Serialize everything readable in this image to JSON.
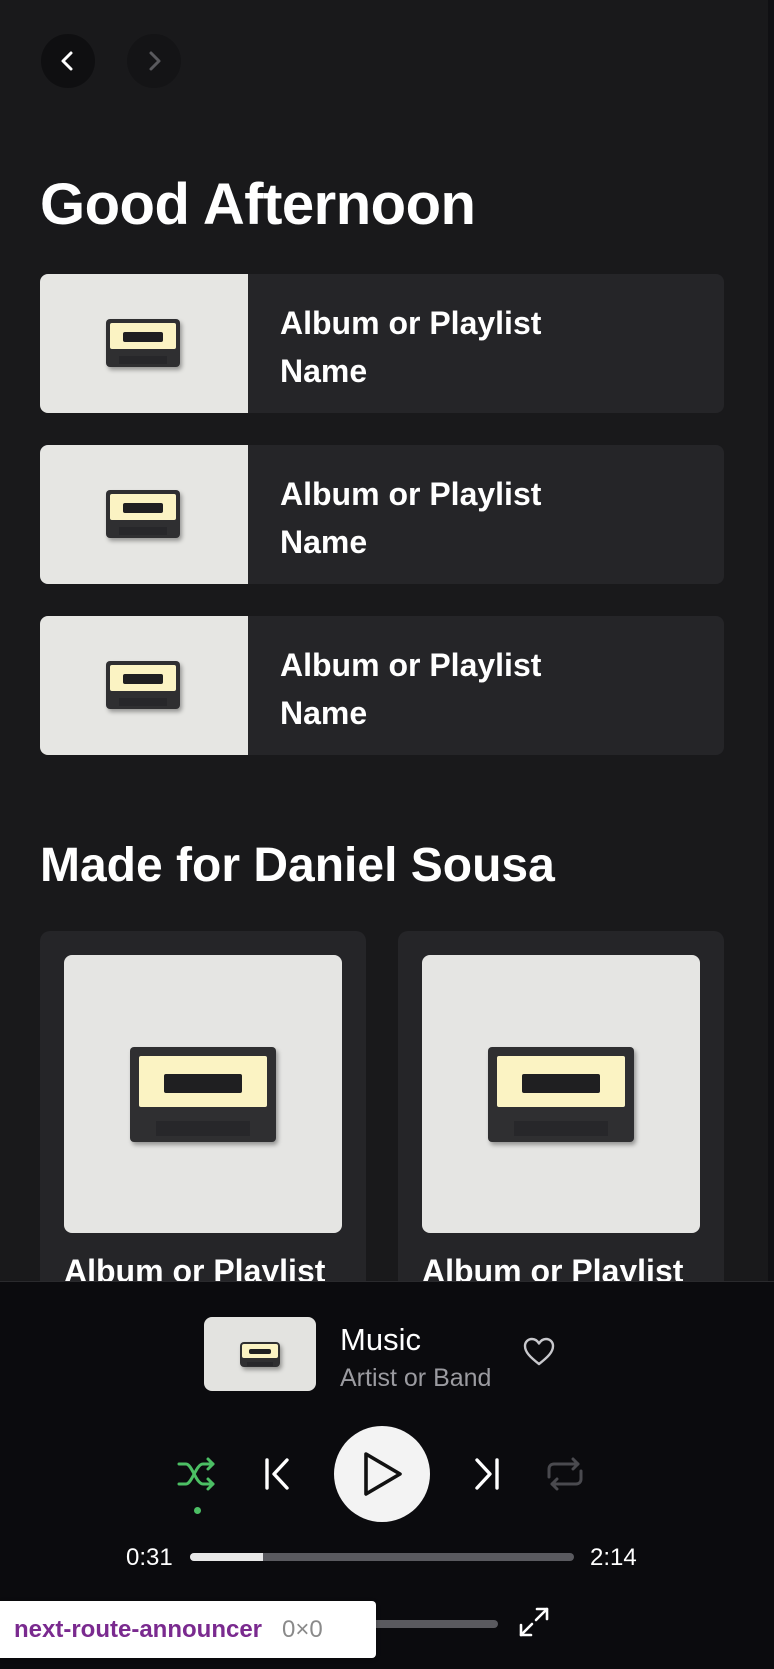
{
  "greeting": "Good Afternoon",
  "quick_picks": [
    {
      "title": "Album or Playlist Name"
    },
    {
      "title": "Album or Playlist Name"
    },
    {
      "title": "Album or Playlist Name"
    }
  ],
  "made_for": {
    "heading": "Made for Daniel Sousa",
    "cards": [
      {
        "title": "Album or Playlist"
      },
      {
        "title": "Album or Playlist"
      }
    ]
  },
  "player": {
    "track_title": "Music",
    "artist": "Artist or Band",
    "elapsed": "0:31",
    "duration": "2:14",
    "progress_fraction": 0.19,
    "volume_fraction": 0.1,
    "shuffle_active": true,
    "accent_color": "#4cbf64"
  },
  "dev_overlay": {
    "name": "next-route-announcer",
    "dimensions": "0×0"
  }
}
